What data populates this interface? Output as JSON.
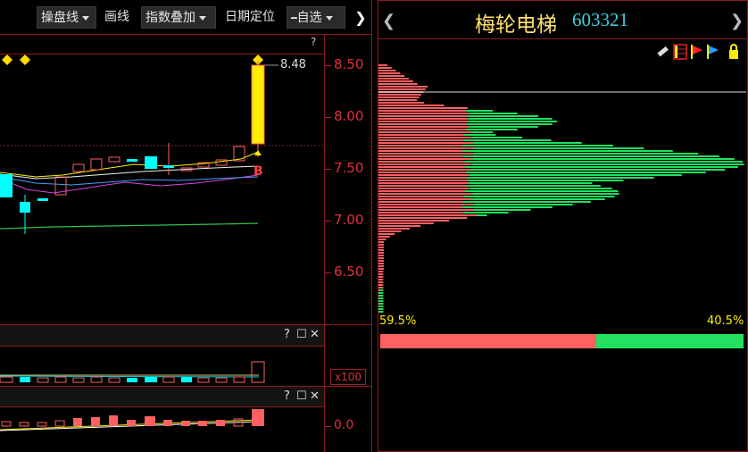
{
  "toolbar": {
    "operate_line": "操盘线",
    "draw_line": "画线",
    "index_overlay": "指数叠加",
    "date_locate": "日期定位",
    "watchlist": "自选",
    "watchlist_prefix": "━",
    "collapse_glyph": "❯",
    "help": "?"
  },
  "main_chart": {
    "price_axis": [
      "8.50",
      "8.00",
      "7.50",
      "7.00",
      "6.50"
    ],
    "high_label": "8.48",
    "buy_marker": "B"
  },
  "volume_panel": {
    "controls": [
      "?",
      "☐",
      "✕"
    ],
    "multiplier": "x100"
  },
  "indicator_panel": {
    "controls": [
      "?",
      "☐",
      "✕"
    ],
    "axis_label": "0.0"
  },
  "right_panel": {
    "stock_name": "梅轮电梯",
    "stock_code": "603321",
    "nav_prev": "❮",
    "nav_next": "❯",
    "left_percent": "59.5%",
    "right_percent": "40.5%",
    "profit_ratio": 0.595
  },
  "colors": {
    "red": "#ff6060",
    "green": "#22e060",
    "yellow": "#ffee00",
    "cyan": "#00ffff",
    "frame_red": "#8a1a20",
    "title_yellow": "#ffe070",
    "code_cyan": "#40d0e0"
  }
}
